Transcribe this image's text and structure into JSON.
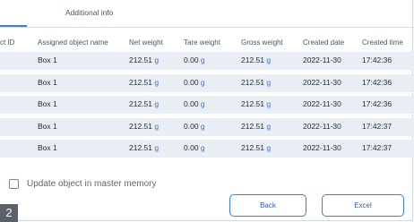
{
  "tabs": {
    "additional_info": "Additional info"
  },
  "table": {
    "headers": [
      "ct ID",
      "Assigned object name",
      "Net weight",
      "Tare weight",
      "Gross weight",
      "Created date",
      "Created time"
    ],
    "rows": [
      {
        "name": "Box 1",
        "net": "212.51",
        "tare": "0.00",
        "gross": "212.51",
        "date": "2022-11-30",
        "time": "17:42:36"
      },
      {
        "name": "Box 1",
        "net": "212.51",
        "tare": "0.00",
        "gross": "212.51",
        "date": "2022-11-30",
        "time": "17:42:36"
      },
      {
        "name": "Box 1",
        "net": "212.51",
        "tare": "0.00",
        "gross": "212.51",
        "date": "2022-11-30",
        "time": "17:42:36"
      },
      {
        "name": "Box 1",
        "net": "212.51",
        "tare": "0.00",
        "gross": "212.51",
        "date": "2022-11-30",
        "time": "17:42:37"
      },
      {
        "name": "Box 1",
        "net": "212.51",
        "tare": "0.00",
        "gross": "212.51",
        "date": "2022-11-30",
        "time": "17:42:37"
      }
    ],
    "unit": "g"
  },
  "options": {
    "update_master_label": "Update object in master memory",
    "update_master_checked": false
  },
  "buttons": {
    "back": "Back",
    "excel": "Excel"
  },
  "badge": "2",
  "colors": {
    "accent": "#3f7fcf",
    "row_bg": "#e9eef5",
    "badge_bg": "#5b6168"
  }
}
